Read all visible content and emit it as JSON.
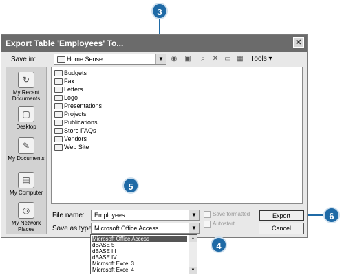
{
  "dialog": {
    "title": "Export Table 'Employees' To...",
    "close_glyph": "✕",
    "save_in_label": "Save in:",
    "save_in_value": "Home Sense",
    "tools_label": "Tools ▾"
  },
  "toolbar_icons": [
    {
      "name": "back-icon",
      "glyph": "◉"
    },
    {
      "name": "up-folder-icon",
      "glyph": "▣"
    },
    {
      "name": "search-web-icon",
      "glyph": "⌕"
    },
    {
      "name": "delete-icon",
      "glyph": "✕"
    },
    {
      "name": "new-folder-icon",
      "glyph": "▭"
    },
    {
      "name": "views-icon",
      "glyph": "▦"
    }
  ],
  "places": [
    {
      "label": "My Recent Documents",
      "glyph": "↻"
    },
    {
      "label": "Desktop",
      "glyph": "▢"
    },
    {
      "label": "My Documents",
      "glyph": "✎"
    },
    {
      "label": "My Computer",
      "glyph": "▤"
    },
    {
      "label": "My Network Places",
      "glyph": "◎"
    }
  ],
  "folders": [
    "Budgets",
    "Fax",
    "Letters",
    "Logo",
    "Presentations",
    "Projects",
    "Publications",
    "Store FAQs",
    "Vendors",
    "Web Site"
  ],
  "file_name_label": "File name:",
  "file_name_value": "Employees",
  "save_as_type_label": "Save as type:",
  "save_as_type_value": "Microsoft Office Access",
  "checkboxes": {
    "save_formatted": "Save formatted",
    "autostart": "Autostart"
  },
  "buttons": {
    "export": "Export",
    "cancel": "Cancel"
  },
  "type_options": [
    "Microsoft Office Access",
    "dBASE 5",
    "dBASE III",
    "dBASE IV",
    "Microsoft Excel 3",
    "Microsoft Excel 4"
  ],
  "callouts": [
    "3",
    "4",
    "5",
    "6"
  ],
  "colors": {
    "callout": "#1f6aa6",
    "titlebar": "#6b6b6b"
  }
}
